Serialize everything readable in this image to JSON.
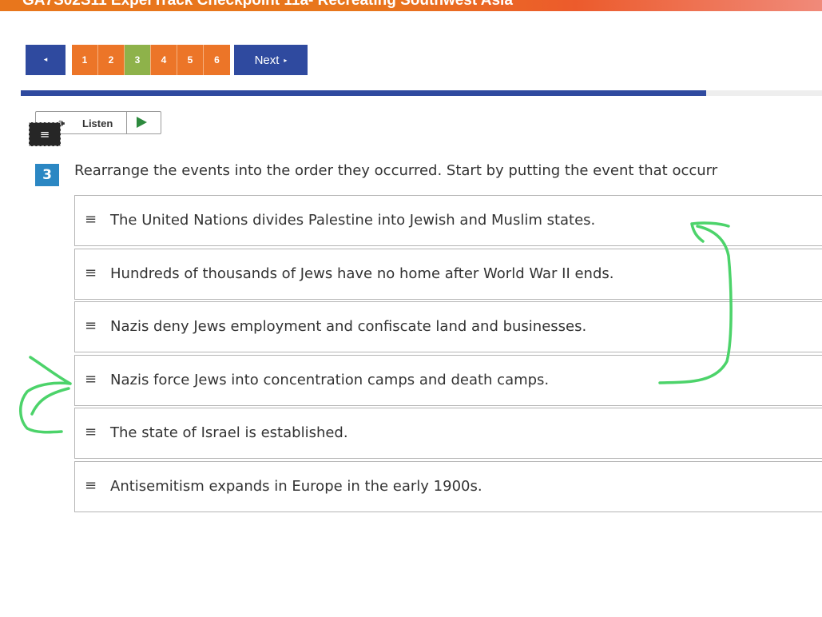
{
  "header": {
    "title": "GA7S02S11 ExperTrack Checkpoint 11a- Recreating Southwest Asia"
  },
  "nav": {
    "prev_icon": "◂",
    "pages": [
      "1",
      "2",
      "3",
      "4",
      "5",
      "6"
    ],
    "current_page": "3",
    "next_label": "Next",
    "next_icon": "▸"
  },
  "progress": {
    "fraction": 0.855
  },
  "listen": {
    "label": "Listen",
    "speaker_icon": "🕪",
    "play_icon": "play-icon"
  },
  "menu": {
    "icon": "≡"
  },
  "question": {
    "number": "3",
    "prompt": "Rearrange the events into the order they occurred. Start by putting the event that occurr",
    "items": [
      "The United Nations divides Palestine into Jewish and Muslim states.",
      "Hundreds of thousands of Jews have no home after World War II ends.",
      "Nazis deny Jews employment and confiscate land and businesses.",
      "Nazis force Jews into concentration camps and death camps.",
      "The state of Israel is established.",
      "Antisemitism expands in Europe in the early 1900s."
    ],
    "grip_icon": "≡"
  },
  "colors": {
    "nav_blue": "#2f4a9f",
    "page_orange": "#ec7528",
    "page_current": "#8eb24a",
    "question_badge": "#2b87c3",
    "annotation_green": "#4cd36a"
  }
}
